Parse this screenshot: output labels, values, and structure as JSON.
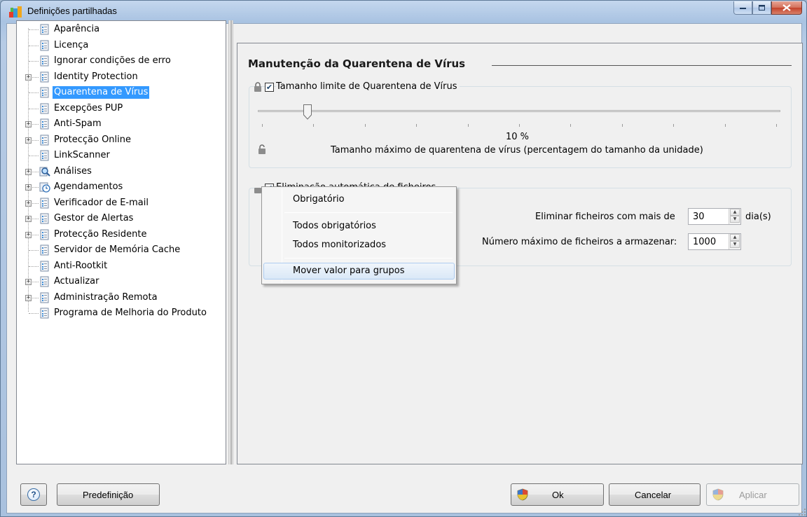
{
  "window": {
    "title": "Definições partilhadas"
  },
  "tree": {
    "items": [
      {
        "label": "Aparência",
        "expandable": false
      },
      {
        "label": "Licença",
        "expandable": false
      },
      {
        "label": "Ignorar condições de erro",
        "expandable": false
      },
      {
        "label": "Identity Protection",
        "expandable": true
      },
      {
        "label": "Quarentena de Vírus",
        "expandable": false,
        "selected": true
      },
      {
        "label": "Excepções PUP",
        "expandable": false
      },
      {
        "label": "Anti-Spam",
        "expandable": true
      },
      {
        "label": "Protecção Online",
        "expandable": true
      },
      {
        "label": "LinkScanner",
        "expandable": false
      },
      {
        "label": "Análises",
        "expandable": true
      },
      {
        "label": "Agendamentos",
        "expandable": true
      },
      {
        "label": "Verificador de E-mail",
        "expandable": true
      },
      {
        "label": "Gestor de Alertas",
        "expandable": true
      },
      {
        "label": "Protecção Residente",
        "expandable": true
      },
      {
        "label": "Servidor de Memória Cache",
        "expandable": false
      },
      {
        "label": "Anti-Rootkit",
        "expandable": false
      },
      {
        "label": "Actualizar",
        "expandable": true
      },
      {
        "label": "Administração Remota",
        "expandable": true
      },
      {
        "label": "Programa de Melhoria do Produto",
        "expandable": false
      }
    ]
  },
  "main": {
    "section_title": "Manutenção da Quarentena de Vírus",
    "size_limit": {
      "label": "Tamanho limite de Quarentena de Vírus",
      "checked": true,
      "slider_percent": 10,
      "value_text": "10 %",
      "description": "Tamanho máximo de quarentena de vírus (percentagem do tamanho da unidade)"
    },
    "auto_delete": {
      "label_partial": "Eliminação automática de ficheiros",
      "checked": true,
      "older_than_label": "Eliminar ficheiros com mais de",
      "older_than_value": "30",
      "older_than_unit": "dia(s)",
      "max_files_label": "Número máximo de ficheiros a armazenar:",
      "max_files_value": "1000"
    }
  },
  "context_menu": {
    "items": [
      "Obrigatório",
      "Todos obrigatórios",
      "Todos monitorizados",
      "Mover valor para grupos"
    ]
  },
  "footer": {
    "default_button": "Predefinição",
    "ok_button": "Ok",
    "cancel_button": "Cancelar",
    "apply_button": "Aplicar"
  }
}
